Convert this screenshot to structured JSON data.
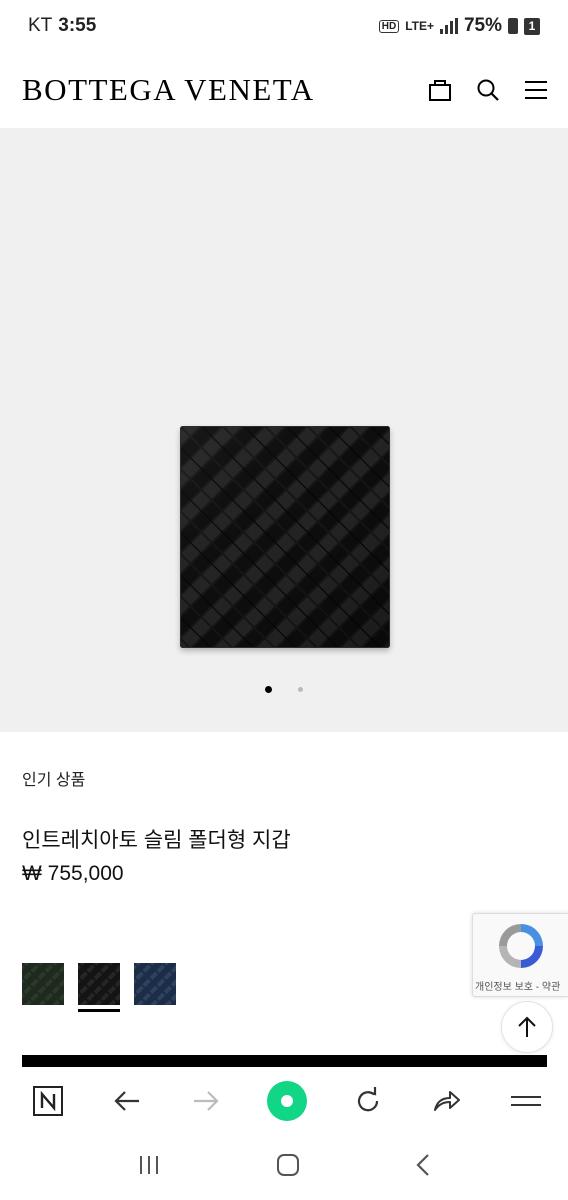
{
  "status_bar": {
    "carrier": "KT",
    "time": "3:55",
    "network_badge": "HD",
    "network_type": "LTE+",
    "battery": "75%",
    "sim_slot": "1",
    "icons": [
      "hd-voice-icon",
      "lte-icon",
      "signal-icon",
      "battery-icon",
      "sim-icon"
    ]
  },
  "header": {
    "logo": "BOTTEGA VENETA",
    "icons": [
      "shopping-bag-icon",
      "search-icon",
      "menu-icon"
    ]
  },
  "hero": {
    "background_color": "#eff0ef",
    "product_color": "#141414",
    "carousel_total": 2,
    "carousel_active": 1
  },
  "product": {
    "section_tag": "인기 상품",
    "name": "인트레치아토 슬림 폴더형 지갑",
    "price": "₩ 755,000",
    "swatches": [
      {
        "name": "dark-green",
        "color": "#1f2a1f",
        "selected": false
      },
      {
        "name": "black",
        "color": "#161616",
        "selected": true
      },
      {
        "name": "navy",
        "color": "#22334d",
        "selected": false
      }
    ]
  },
  "recaptcha": {
    "links": "개인정보 보호 - 약관"
  },
  "browser_toolbar": {
    "icons": [
      "naver-home-icon",
      "back-arrow-icon",
      "forward-arrow-icon",
      "green-dot-icon",
      "reload-icon",
      "share-icon",
      "hamburger-menu-icon"
    ],
    "accent_color": "#10d686"
  },
  "system_nav": {
    "icons": [
      "recent-apps-icon",
      "home-icon",
      "back-icon"
    ]
  }
}
